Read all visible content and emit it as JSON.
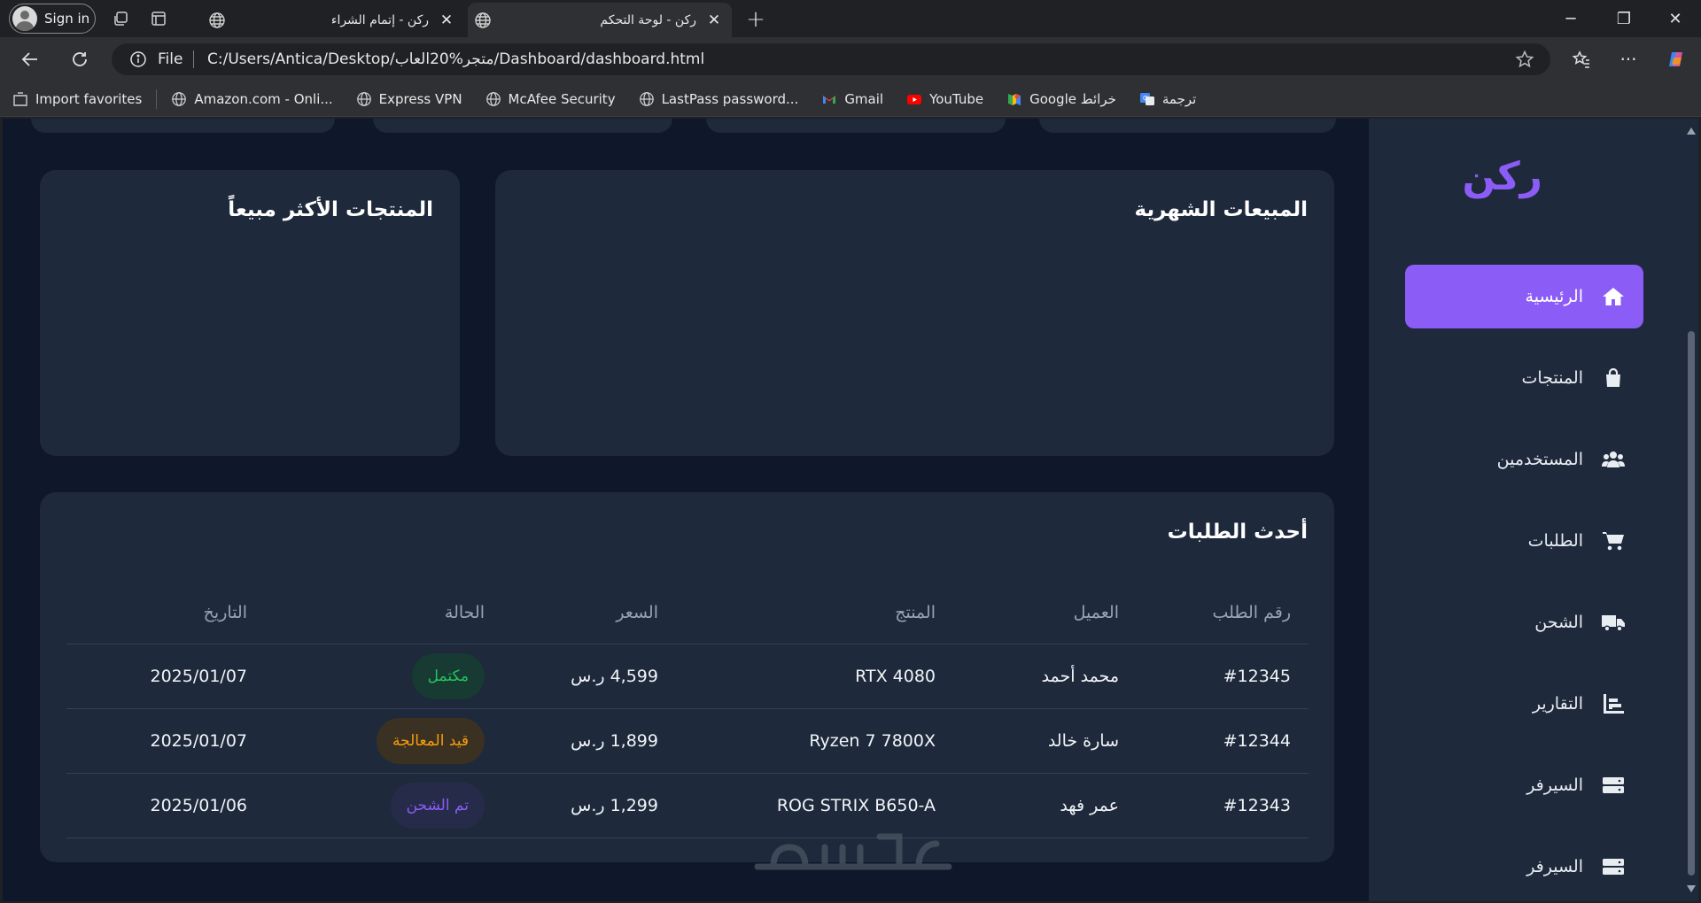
{
  "browser": {
    "profile_label": "Sign in",
    "tabs": [
      {
        "title": "ركن - إتمام الشراء",
        "active": false
      },
      {
        "title": "ركن - لوحة التحكم",
        "active": true
      }
    ],
    "address": {
      "scheme_label": "File",
      "url": "C:/Users/Antica/Desktop/متجر%20العاب/Dashboard/dashboard.html"
    },
    "bookmarks": [
      {
        "label": "Import favorites",
        "icon": "import-icon"
      },
      {
        "label": "Amazon.com - Onli...",
        "icon": "globe-icon"
      },
      {
        "label": "Express VPN",
        "icon": "globe-icon"
      },
      {
        "label": "McAfee Security",
        "icon": "globe-icon"
      },
      {
        "label": "LastPass password...",
        "icon": "globe-icon"
      },
      {
        "label": "Gmail",
        "icon": "gmail-icon"
      },
      {
        "label": "YouTube",
        "icon": "youtube-icon"
      },
      {
        "label": "Google خرائط",
        "icon": "maps-icon"
      },
      {
        "label": "ترجمة",
        "icon": "translate-icon"
      }
    ]
  },
  "sidebar": {
    "logo": "ركن",
    "accent": "#8b5cf6",
    "items": [
      {
        "label": "الرئيسية",
        "icon": "home-icon",
        "active": true
      },
      {
        "label": "المنتجات",
        "icon": "shopping-bag-icon",
        "active": false
      },
      {
        "label": "المستخدمين",
        "icon": "users-icon",
        "active": false
      },
      {
        "label": "الطلبات",
        "icon": "cart-icon",
        "active": false
      },
      {
        "label": "الشحن",
        "icon": "truck-icon",
        "active": false
      },
      {
        "label": "التقارير",
        "icon": "chart-icon",
        "active": false
      },
      {
        "label": "السيرفر",
        "icon": "server-icon",
        "active": false
      },
      {
        "label": "السيرفر",
        "icon": "server-icon",
        "active": false
      }
    ]
  },
  "cards": {
    "monthly_sales_title": "المبيعات الشهرية",
    "top_products_title": "المنتجات الأكثر مبيعاً"
  },
  "orders": {
    "title": "أحدث الطلبات",
    "columns": [
      "رقم الطلب",
      "العميل",
      "المنتج",
      "السعر",
      "الحالة",
      "التاريخ"
    ],
    "rows": [
      {
        "id": "#12345",
        "customer": "محمد أحمد",
        "product": "RTX 4080",
        "price": "4,599 ر.س",
        "status": "مكتمل",
        "date": "2025/01/07"
      },
      {
        "id": "#12344",
        "customer": "سارة خالد",
        "product": "Ryzen 7 7800X",
        "price": "1,899 ر.س",
        "status": "قيد المعالجة",
        "date": "2025/01/07"
      },
      {
        "id": "#12343",
        "customer": "عمر فهد",
        "product": "ROG STRIX B650-A",
        "price": "1,299 ر.س",
        "status": "تم الشحن",
        "date": "2025/01/06"
      }
    ],
    "status_colors": {
      "مكتمل": {
        "fg": "#22c55e",
        "bg": "#173a32"
      },
      "قيد المعالجة": {
        "fg": "#f59e0b",
        "bg": "#3a3123"
      },
      "تم الشحن": {
        "fg": "#8b5cf6",
        "bg": "#272b4a"
      }
    }
  },
  "colors": {
    "page_bg": "#0f172a",
    "card_bg": "#1e293b"
  }
}
